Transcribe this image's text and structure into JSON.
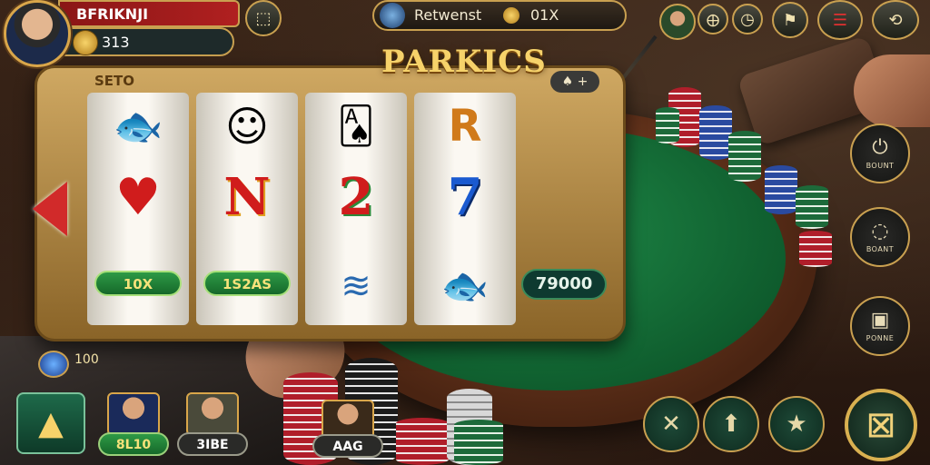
{
  "player": {
    "name": "BFRIKNJI",
    "coins": "313"
  },
  "top_center": {
    "label": "Retwenst",
    "amount": "01X"
  },
  "slot": {
    "title": "PARKICS",
    "sub_label": "SETO",
    "add_label": "+",
    "reels": [
      {
        "row2": "♥",
        "payline": "10X"
      },
      {
        "row2": "N",
        "payline": "1S2AS"
      },
      {
        "row2": "2",
        "payline": ""
      },
      {
        "row2": "7",
        "payline": ""
      }
    ],
    "win_amount": "79000"
  },
  "side_buttons": [
    {
      "icon": "power-icon",
      "label": "BOUNT"
    },
    {
      "icon": "bag-icon",
      "label": "BOANT"
    },
    {
      "icon": "briefcase-icon",
      "label": "PONNE"
    }
  ],
  "bottom": {
    "gem_count": "100",
    "players": [
      {
        "label": "8L10"
      },
      {
        "label": "3IBE"
      },
      {
        "label": "AAG"
      }
    ]
  },
  "colors": {
    "gold": "#c9a050",
    "felt": "#1f8a48",
    "red": "#b02020"
  }
}
